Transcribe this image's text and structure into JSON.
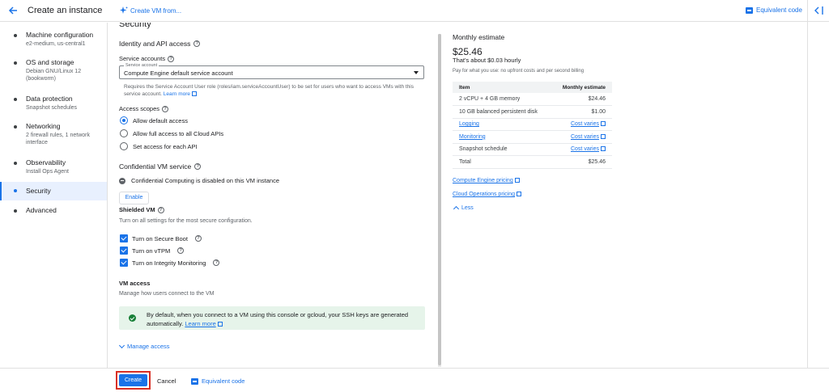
{
  "header": {
    "title": "Create an instance",
    "create_from": "Create VM from...",
    "equivalent_code": "Equivalent code"
  },
  "nav": {
    "items": [
      {
        "label": "Machine configuration",
        "sub": "e2-medium, us-central1"
      },
      {
        "label": "OS and storage",
        "sub": "Debian GNU/Linux 12 (bookworm)"
      },
      {
        "label": "Data protection",
        "sub": "Snapshot schedules"
      },
      {
        "label": "Networking",
        "sub": "2 firewall rules, 1 network interface"
      },
      {
        "label": "Observability",
        "sub": "Install Ops Agent"
      },
      {
        "label": "Security",
        "sub": ""
      },
      {
        "label": "Advanced",
        "sub": ""
      }
    ],
    "active_index": 5
  },
  "main": {
    "section_title": "Security",
    "identity": {
      "heading": "Identity and API access",
      "service_accounts_label": "Service accounts",
      "select_float_label": "Service account",
      "select_value": "Compute Engine default service account",
      "helper_text": "Requires the Service Account User role (roles/iam.serviceAccountUser) to be set for users who want to access VMs with this service account.",
      "learn_more": "Learn more",
      "access_scopes_label": "Access scopes",
      "scopes": [
        {
          "label": "Allow default access",
          "checked": true
        },
        {
          "label": "Allow full access to all Cloud APIs",
          "checked": false
        },
        {
          "label": "Set access for each API",
          "checked": false
        }
      ]
    },
    "confidential": {
      "heading": "Confidential VM service",
      "status": "Confidential Computing is disabled on this VM instance",
      "enable_label": "Enable"
    },
    "shielded": {
      "heading": "Shielded VM",
      "description": "Turn on all settings for the most secure configuration.",
      "options": [
        {
          "label": "Turn on Secure Boot",
          "checked": true
        },
        {
          "label": "Turn on vTPM",
          "checked": true
        },
        {
          "label": "Turn on Integrity Monitoring",
          "checked": true
        }
      ]
    },
    "vm_access": {
      "heading": "VM access",
      "description": "Manage how users connect to the VM",
      "banner": "By default, when you connect to a VM using this console or gcloud, your SSH keys are generated automatically.",
      "learn_more": "Learn more",
      "manage_access": "Manage access"
    }
  },
  "estimate": {
    "title": "Monthly estimate",
    "amount": "$25.46",
    "hourly": "That's about $0.03 hourly",
    "note": "Pay for what you use: no upfront costs and per second billing",
    "table_headers": [
      "Item",
      "Monthly estimate"
    ],
    "rows": [
      {
        "item": "2 vCPU + 4 GB memory",
        "value": "$24.46",
        "link": false
      },
      {
        "item": "10 GB balanced persistent disk",
        "value": "$1.00",
        "link": false
      },
      {
        "item": "Logging",
        "value": "Cost varies",
        "link": true
      },
      {
        "item": "Monitoring",
        "value": "Cost varies",
        "link": true
      },
      {
        "item": "Snapshot schedule",
        "value": "Cost varies",
        "link": true
      },
      {
        "item": "Total",
        "value": "$25.46",
        "link": false
      }
    ],
    "pricing_links": [
      "Compute Engine pricing",
      "Cloud Operations pricing"
    ],
    "less_label": "Less"
  },
  "footer": {
    "create_label": "Create",
    "cancel_label": "Cancel",
    "equivalent_code": "Equivalent code"
  },
  "colors": {
    "accent": "#1a73e8",
    "highlight_outline": "#d93025",
    "success_bg": "#e6f4ea"
  }
}
